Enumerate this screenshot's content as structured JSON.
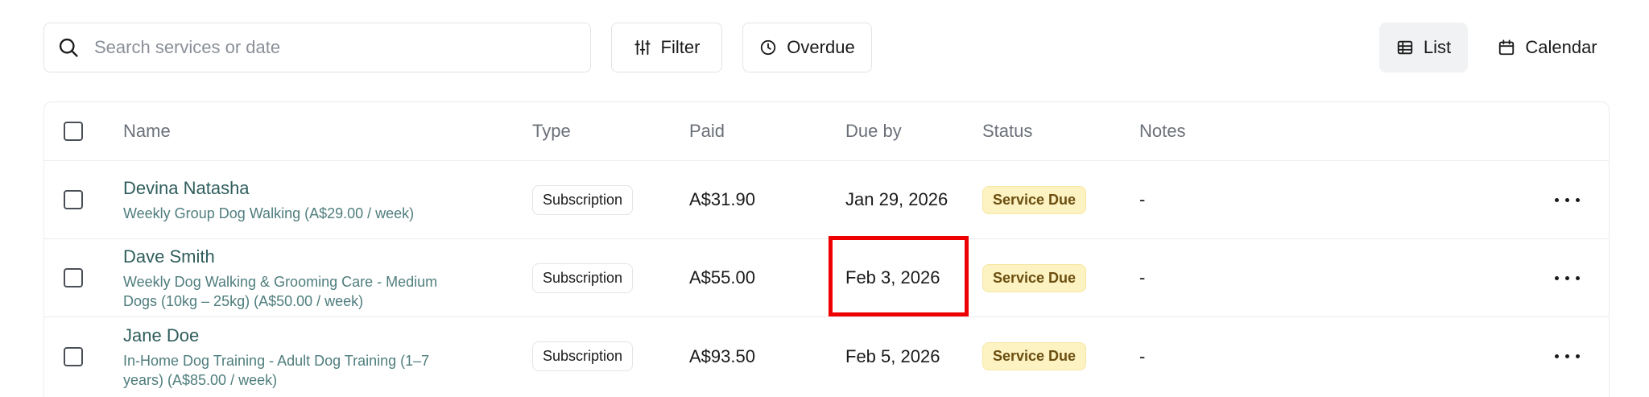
{
  "toolbar": {
    "search_placeholder": "Search services or date",
    "filter_label": "Filter",
    "overdue_label": "Overdue",
    "list_label": "List",
    "calendar_label": "Calendar"
  },
  "table": {
    "columns": [
      "Name",
      "Type",
      "Paid",
      "Due by",
      "Status",
      "Notes"
    ],
    "rows": [
      {
        "name": "Devina Natasha",
        "service": "Weekly Group Dog Walking (A$29.00 / week)",
        "type": "Subscription",
        "paid": "A$31.90",
        "due": "Jan 29, 2026",
        "status": "Service Due",
        "notes": "-"
      },
      {
        "name": "Dave Smith",
        "service": "Weekly Dog Walking & Grooming Care - Medium Dogs (10kg – 25kg) (A$50.00 / week)",
        "type": "Subscription",
        "paid": "A$55.00",
        "due": "Feb 3, 2026",
        "status": "Service Due",
        "notes": "-"
      },
      {
        "name": "Jane Doe",
        "service": "In-Home Dog Training - Adult Dog Training (1–7 years) (A$85.00 / week)",
        "type": "Subscription",
        "paid": "A$93.50",
        "due": "Feb 5, 2026",
        "status": "Service Due",
        "notes": "-"
      }
    ]
  },
  "colors": {
    "highlight": "#ee0000",
    "status_bg": "#fdf3c2",
    "status_text": "#6b4e10",
    "name_text": "#2f5d5c"
  },
  "icons": [
    "search-icon",
    "filter-icon",
    "clock-icon",
    "list-icon",
    "calendar-icon",
    "more-icon"
  ]
}
